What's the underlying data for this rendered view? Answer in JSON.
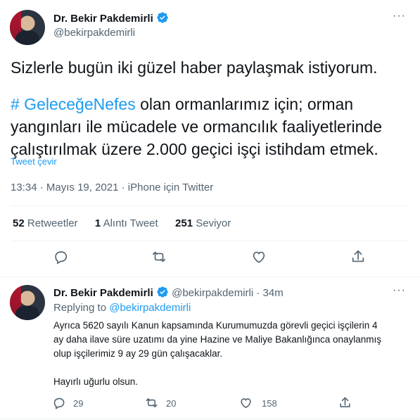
{
  "tweet": {
    "author_name": "Dr. Bekir Pakdemirli",
    "author_handle": "@bekirpakdemirli",
    "line1": "Sizlerle bugün iki güzel haber paylaşmak istiyorum.",
    "hashtag": "# GeleceğeNefes",
    "line2_rest": " olan ormanlarımız için; orman",
    "line3": "yangınları ile mücadele ve ormancılık faaliyetlerinde",
    "line4": "çalıştırılmak üzere 2.000 geçici işçi istihdam etmek.",
    "translate_label": "Tweet çevir",
    "time": "13:34",
    "date": "Mayıs 19, 2021",
    "source": "iPhone için Twitter",
    "separator": "·",
    "more_label": "···"
  },
  "stats": {
    "retweets_count": "52",
    "retweets_label": "Retweetler",
    "quotes_count": "1",
    "quotes_label": "Alıntı Tweet",
    "likes_count": "251",
    "likes_label": "Seviyor"
  },
  "reply": {
    "author_name": "Dr. Bekir Pakdemirli",
    "author_handle": "@bekirpakdemirli",
    "time_ago": "34m",
    "separator": "·",
    "replying_prefix": "Replying to ",
    "replying_handle": "@bekirpakdemirli",
    "line1": "Ayrıca 5620 sayılı Kanun kapsamında Kurumumuzda görevli geçici işçilerin 4",
    "line2": "ay daha ilave süre uzatımı da yine Hazine ve Maliye Bakanlığınca onaylanmış",
    "line3": "olup işçilerimiz 9 ay 29 gün çalışacaklar.",
    "line4": "Hayırlı uğurlu olsun.",
    "replies_count": "29",
    "retweets_count": "20",
    "likes_count": "158",
    "more_label": "···"
  },
  "colors": {
    "accent": "#1d9bf0",
    "muted": "#536471",
    "divider": "#eff3f4"
  },
  "icons": [
    "verified-badge-icon",
    "reply-icon",
    "retweet-icon",
    "like-icon",
    "share-icon",
    "more-icon"
  ]
}
